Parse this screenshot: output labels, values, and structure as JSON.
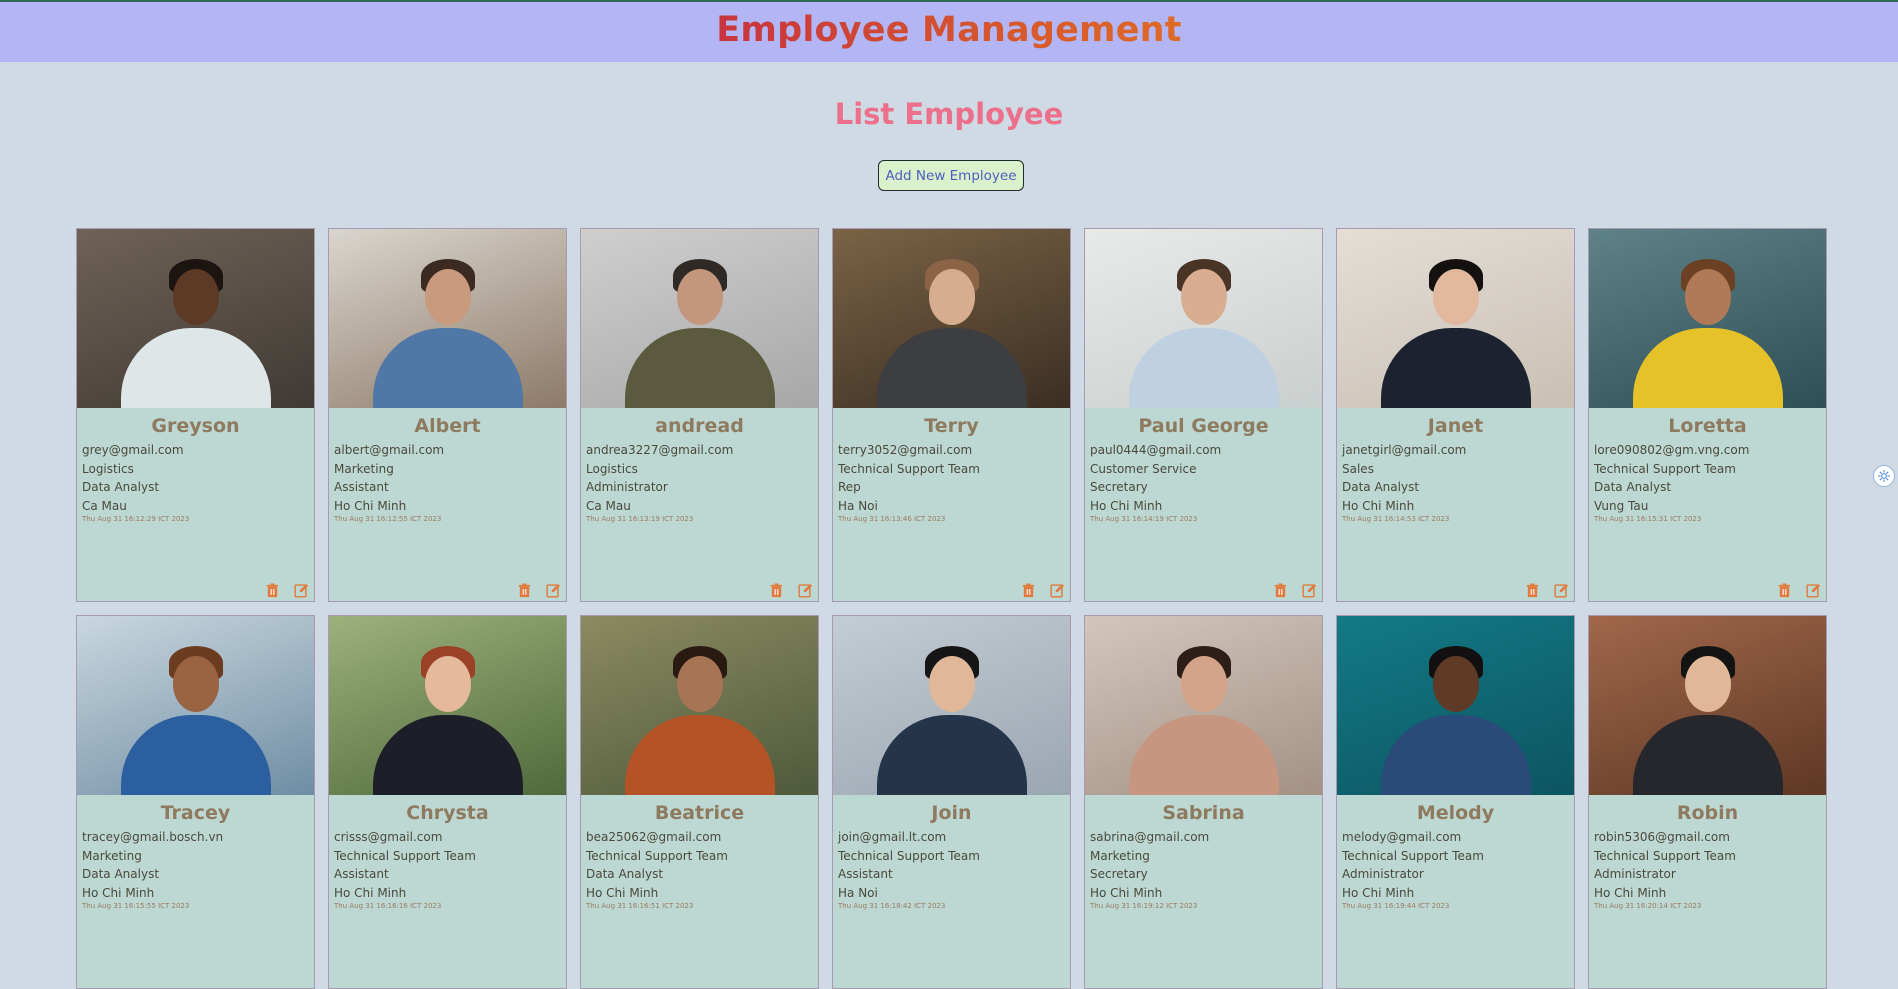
{
  "header": {
    "title": "Employee Management"
  },
  "main": {
    "title": "List Employee",
    "add_button": "Add New Employee"
  },
  "employees": [
    {
      "name": "Greyson",
      "email": "grey@gmail.com",
      "department": "Logistics",
      "position": "Data Analyst",
      "city": "Ca Mau",
      "created": "Thu Aug 31 16:12:29 ICT 2023",
      "actions": true,
      "photo": {
        "bg": "#6f6256",
        "bg2": "#3f3a35",
        "skin": "#5c3a25",
        "hair": "#1c1410",
        "cloth": "#dfe6e8"
      }
    },
    {
      "name": "Albert",
      "email": "albert@gmail.com",
      "department": "Marketing",
      "position": "Assistant",
      "city": "Ho Chi Minh",
      "created": "Thu Aug 31 16:12:55 ICT 2023",
      "actions": true,
      "photo": {
        "bg": "#d9d6cf",
        "bg2": "#8e7a68",
        "skin": "#c99a7e",
        "hair": "#3a2a20",
        "cloth": "#4f78a6"
      }
    },
    {
      "name": "andread",
      "email": "andrea3227@gmail.com",
      "department": "Logistics",
      "position": "Administrator",
      "city": "Ca Mau",
      "created": "Thu Aug 31 16:13:19 ICT 2023",
      "actions": true,
      "photo": {
        "bg": "#cfcfcf",
        "bg2": "#a7a7a7",
        "skin": "#c4967d",
        "hair": "#2f2a26",
        "cloth": "#5b5a3f"
      }
    },
    {
      "name": "Terry",
      "email": "terry3052@gmail.com",
      "department": "Technical Support Team",
      "position": "Rep",
      "city": "Ha Noi",
      "created": "Thu Aug 31 16:13:46 ICT 2023",
      "actions": true,
      "photo": {
        "bg": "#7a6346",
        "bg2": "#3b2e22",
        "skin": "#d6ae8f",
        "hair": "#8a6444",
        "cloth": "#3d3e42"
      }
    },
    {
      "name": "Paul George",
      "email": "paul0444@gmail.com",
      "department": "Customer Service",
      "position": "Secretary",
      "city": "Ho Chi Minh",
      "created": "Thu Aug 31 16:14:19 ICT 2023",
      "actions": true,
      "photo": {
        "bg": "#e8eae9",
        "bg2": "#c9cfce",
        "skin": "#d9ad92",
        "hair": "#4a3426",
        "cloth": "#bfd0e1"
      }
    },
    {
      "name": "Janet",
      "email": "janetgirl@gmail.com",
      "department": "Sales",
      "position": "Data Analyst",
      "city": "Ho Chi Minh",
      "created": "Thu Aug 31 16:14:53 ICT 2023",
      "actions": true,
      "photo": {
        "bg": "#e4ded6",
        "bg2": "#c9c0b4",
        "skin": "#e2b89e",
        "hair": "#151111",
        "cloth": "#1d2230"
      }
    },
    {
      "name": "Loretta",
      "email": "lore090802@gm.vng.com",
      "department": "Technical Support Team",
      "position": "Data Analyst",
      "city": "Vung Tau",
      "created": "Thu Aug 31 16:15:31 ICT 2023",
      "actions": true,
      "photo": {
        "bg": "#5f8188",
        "bg2": "#2f4e56",
        "skin": "#b07a57",
        "hair": "#6b4023",
        "cloth": "#e6c229"
      }
    },
    {
      "name": "Tracey",
      "email": "tracey@gmail.bosch.vn",
      "department": "Marketing",
      "position": "Data Analyst",
      "city": "Ho Chi Minh",
      "created": "Thu Aug 31 16:15:55 ICT 2023",
      "actions": false,
      "photo": {
        "bg": "#c9d7df",
        "bg2": "#6f8da4",
        "skin": "#9a6342",
        "hair": "#6b3c1f",
        "cloth": "#2c5f9f"
      }
    },
    {
      "name": "Chrysta",
      "email": "crisss@gmail.com",
      "department": "Technical Support Team",
      "position": "Assistant",
      "city": "Ho Chi Minh",
      "created": "Thu Aug 31 16:16:16 ICT 2023",
      "actions": false,
      "photo": {
        "bg": "#9db17b",
        "bg2": "#4f6a3c",
        "skin": "#e5b99c",
        "hair": "#9a4226",
        "cloth": "#1d1f28"
      }
    },
    {
      "name": "Beatrice",
      "email": "bea25062@gmail.com",
      "department": "Technical Support Team",
      "position": "Data Analyst",
      "city": "Ho Chi Minh",
      "created": "Thu Aug 31 16:16:51 ICT 2023",
      "actions": false,
      "photo": {
        "bg": "#8c8a62",
        "bg2": "#4e5a3b",
        "skin": "#a87456",
        "hair": "#2a1a12",
        "cloth": "#b45426"
      }
    },
    {
      "name": "Join",
      "email": "join@gmail.lt.com",
      "department": "Technical Support Team",
      "position": "Assistant",
      "city": "Ha Noi",
      "created": "Thu Aug 31 16:18:42 ICT 2023",
      "actions": false,
      "photo": {
        "bg": "#c4ccd3",
        "bg2": "#9aa6b1",
        "skin": "#e0b798",
        "hair": "#161616",
        "cloth": "#243449"
      }
    },
    {
      "name": "Sabrina",
      "email": "sabrina@gmail.com",
      "department": "Marketing",
      "position": "Secretary",
      "city": "Ho Chi Minh",
      "created": "Thu Aug 31 16:19:12 ICT 2023",
      "actions": false,
      "photo": {
        "bg": "#d2c6bc",
        "bg2": "#a49184",
        "skin": "#d4a48a",
        "hair": "#2d1f17",
        "cloth": "#c79680"
      }
    },
    {
      "name": "Melody",
      "email": "melody@gmail.com",
      "department": "Technical Support Team",
      "position": "Administrator",
      "city": "Ho Chi Minh",
      "created": "Thu Aug 31 16:19:44 ICT 2023",
      "actions": false,
      "photo": {
        "bg": "#137a86",
        "bg2": "#0c5560",
        "skin": "#5f3a26",
        "hair": "#121010",
        "cloth": "#2a4a7a"
      }
    },
    {
      "name": "Robin",
      "email": "robin5306@gmail.com",
      "department": "Technical Support Team",
      "position": "Administrator",
      "city": "Ho Chi Minh",
      "created": "Thu Aug 31 16:20:14 ICT 2023",
      "actions": false,
      "photo": {
        "bg": "#a1674a",
        "bg2": "#5e3825",
        "skin": "#e0b797",
        "hair": "#141313",
        "cloth": "#25272c"
      }
    }
  ],
  "icons": {
    "delete": "trash-icon",
    "edit": "edit-icon",
    "fab": "settings-icon"
  },
  "colors": {
    "accent": "#e07b3f",
    "header_bg": "#b4b5f4",
    "page_bg": "#d0dae4",
    "card_bg": "#bdd7d2"
  }
}
